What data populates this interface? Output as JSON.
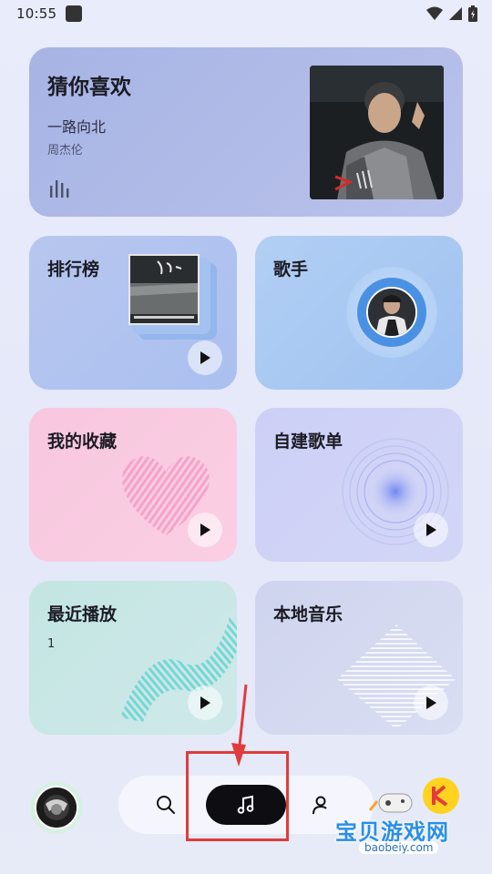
{
  "status_bar": {
    "time": "10:55"
  },
  "hero": {
    "title": "猜你喜欢",
    "song": "一路向北",
    "artist": "周杰伦"
  },
  "cards": {
    "rank": {
      "title": "排行榜"
    },
    "singer": {
      "title": "歌手"
    },
    "favorites": {
      "title": "我的收藏"
    },
    "playlist": {
      "title": "自建歌单"
    },
    "recent": {
      "title": "最近播放",
      "count": "1"
    },
    "local": {
      "title": "本地音乐"
    }
  },
  "watermark": {
    "title": "宝贝游戏网",
    "url": "baobeiy.com"
  },
  "colors": {
    "accent_dark": "#0d0d12",
    "highlight_red": "#e23b3b"
  }
}
